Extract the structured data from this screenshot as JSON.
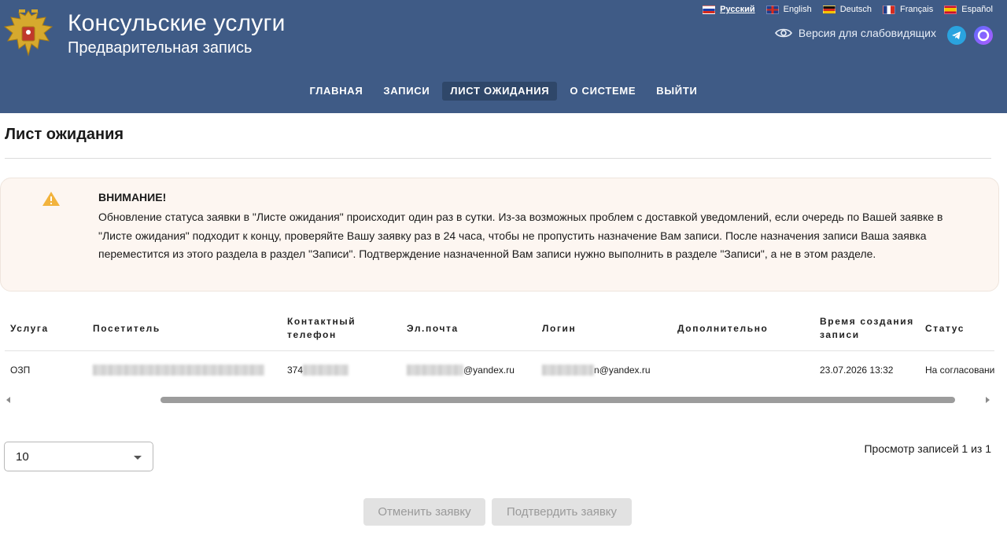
{
  "header": {
    "title": "Консульские услуги",
    "subtitle": "Предварительная запись",
    "accessibility_label": "Версия для слабовидящих",
    "languages": [
      {
        "label": "Русский",
        "active": true
      },
      {
        "label": "English",
        "active": false
      },
      {
        "label": "Deutsch",
        "active": false
      },
      {
        "label": "Français",
        "active": false
      },
      {
        "label": "Español",
        "active": false
      }
    ]
  },
  "nav": {
    "items": [
      {
        "label": "ГЛАВНАЯ"
      },
      {
        "label": "ЗАПИСИ"
      },
      {
        "label": "ЛИСТ ОЖИДАНИЯ",
        "active": true
      },
      {
        "label": "О СИСТЕМЕ"
      },
      {
        "label": "ВЫЙТИ"
      }
    ]
  },
  "page": {
    "title": "Лист ожидания"
  },
  "alert": {
    "title": "ВНИМАНИЕ!",
    "text": "Обновление статуса заявки в \"Листе ожидания\" происходит один раз в сутки. Из-за возможных проблем с доставкой уведомлений, если очередь по Вашей заявке в \"Листе ожидания\" подходит к концу, проверяйте Вашу заявку раз в 24 часа, чтобы не пропустить назначение Вам записи. После назначения записи Ваша заявка переместится из этого раздела в раздел \"Записи\". Подтверждение назначенной Вам записи нужно выполнить в разделе \"Записи\", а не в этом разделе."
  },
  "table": {
    "columns": [
      "Услуга",
      "Посетитель",
      "Контактный телефон",
      "Эл.почта",
      "Логин",
      "Дополнительно",
      "Время создания записи",
      "Статус"
    ],
    "row": {
      "service": "ОЗП",
      "phone_prefix": "374",
      "email_suffix": "@yandex.ru",
      "login_suffix": "n@yandex.ru",
      "extra": "",
      "created": "23.07.2026 13:32",
      "status": "На согласовании"
    }
  },
  "pagination": {
    "page_size": "10",
    "records_text": "Просмотр записей 1 из 1"
  },
  "actions": {
    "cancel_label": "Отменить заявку",
    "confirm_label": "Подтвердить заявку"
  },
  "colors": {
    "header_bg": "#3f5b86",
    "nav_active_bg": "#2f4769",
    "alert_bg": "#fdf6f1",
    "warning": "#f2b33d"
  }
}
